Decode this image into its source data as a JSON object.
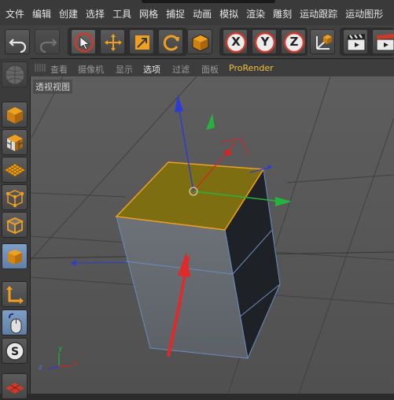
{
  "menu": {
    "items": [
      "文件",
      "编辑",
      "创建",
      "选择",
      "工具",
      "网格",
      "捕捉",
      "动画",
      "模拟",
      "渲染",
      "雕刻",
      "运动跟踪",
      "运动图形"
    ]
  },
  "toolbar": {
    "undo": "undo-icon",
    "redo": "redo-icon",
    "axis_x": "X",
    "axis_y": "Y",
    "axis_z": "Z"
  },
  "view_menu": {
    "items": [
      "查看",
      "摄像机",
      "显示",
      "选项",
      "过滤",
      "面板",
      "ProRender"
    ]
  },
  "viewport": {
    "label": "透视视图",
    "axis_x": "x",
    "axis_y": "y",
    "axis_z": "z"
  },
  "colors": {
    "accent_blue": "#6a8cc0",
    "selected_face": "#7d6e12",
    "axis_x": "#d72323",
    "axis_y": "#24b43c",
    "axis_z": "#2d3cd2",
    "prorender": "#f0c040"
  }
}
